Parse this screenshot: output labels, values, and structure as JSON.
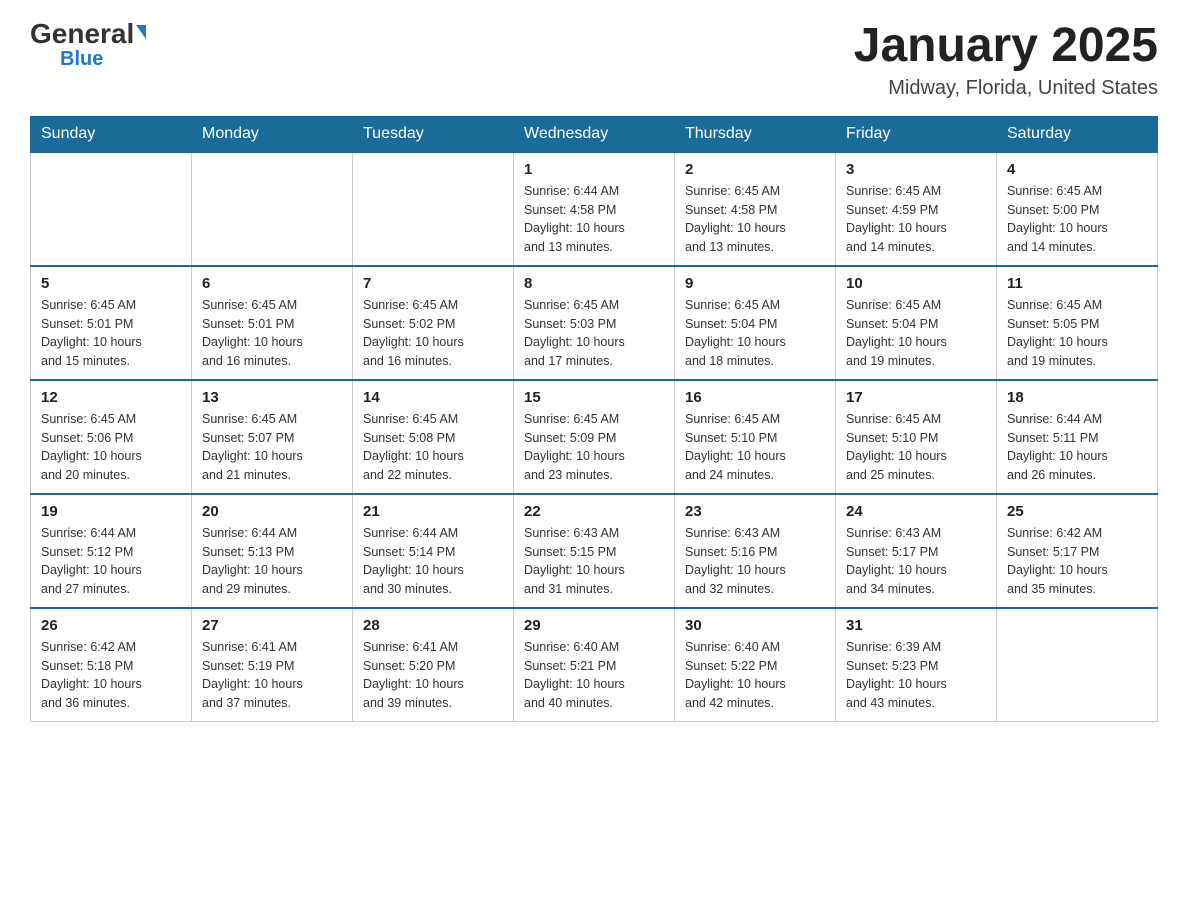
{
  "header": {
    "logo_general": "General",
    "logo_blue": "Blue",
    "month_title": "January 2025",
    "location": "Midway, Florida, United States"
  },
  "days_of_week": [
    "Sunday",
    "Monday",
    "Tuesday",
    "Wednesday",
    "Thursday",
    "Friday",
    "Saturday"
  ],
  "weeks": [
    [
      {
        "day": "",
        "info": ""
      },
      {
        "day": "",
        "info": ""
      },
      {
        "day": "",
        "info": ""
      },
      {
        "day": "1",
        "info": "Sunrise: 6:44 AM\nSunset: 4:58 PM\nDaylight: 10 hours\nand 13 minutes."
      },
      {
        "day": "2",
        "info": "Sunrise: 6:45 AM\nSunset: 4:58 PM\nDaylight: 10 hours\nand 13 minutes."
      },
      {
        "day": "3",
        "info": "Sunrise: 6:45 AM\nSunset: 4:59 PM\nDaylight: 10 hours\nand 14 minutes."
      },
      {
        "day": "4",
        "info": "Sunrise: 6:45 AM\nSunset: 5:00 PM\nDaylight: 10 hours\nand 14 minutes."
      }
    ],
    [
      {
        "day": "5",
        "info": "Sunrise: 6:45 AM\nSunset: 5:01 PM\nDaylight: 10 hours\nand 15 minutes."
      },
      {
        "day": "6",
        "info": "Sunrise: 6:45 AM\nSunset: 5:01 PM\nDaylight: 10 hours\nand 16 minutes."
      },
      {
        "day": "7",
        "info": "Sunrise: 6:45 AM\nSunset: 5:02 PM\nDaylight: 10 hours\nand 16 minutes."
      },
      {
        "day": "8",
        "info": "Sunrise: 6:45 AM\nSunset: 5:03 PM\nDaylight: 10 hours\nand 17 minutes."
      },
      {
        "day": "9",
        "info": "Sunrise: 6:45 AM\nSunset: 5:04 PM\nDaylight: 10 hours\nand 18 minutes."
      },
      {
        "day": "10",
        "info": "Sunrise: 6:45 AM\nSunset: 5:04 PM\nDaylight: 10 hours\nand 19 minutes."
      },
      {
        "day": "11",
        "info": "Sunrise: 6:45 AM\nSunset: 5:05 PM\nDaylight: 10 hours\nand 19 minutes."
      }
    ],
    [
      {
        "day": "12",
        "info": "Sunrise: 6:45 AM\nSunset: 5:06 PM\nDaylight: 10 hours\nand 20 minutes."
      },
      {
        "day": "13",
        "info": "Sunrise: 6:45 AM\nSunset: 5:07 PM\nDaylight: 10 hours\nand 21 minutes."
      },
      {
        "day": "14",
        "info": "Sunrise: 6:45 AM\nSunset: 5:08 PM\nDaylight: 10 hours\nand 22 minutes."
      },
      {
        "day": "15",
        "info": "Sunrise: 6:45 AM\nSunset: 5:09 PM\nDaylight: 10 hours\nand 23 minutes."
      },
      {
        "day": "16",
        "info": "Sunrise: 6:45 AM\nSunset: 5:10 PM\nDaylight: 10 hours\nand 24 minutes."
      },
      {
        "day": "17",
        "info": "Sunrise: 6:45 AM\nSunset: 5:10 PM\nDaylight: 10 hours\nand 25 minutes."
      },
      {
        "day": "18",
        "info": "Sunrise: 6:44 AM\nSunset: 5:11 PM\nDaylight: 10 hours\nand 26 minutes."
      }
    ],
    [
      {
        "day": "19",
        "info": "Sunrise: 6:44 AM\nSunset: 5:12 PM\nDaylight: 10 hours\nand 27 minutes."
      },
      {
        "day": "20",
        "info": "Sunrise: 6:44 AM\nSunset: 5:13 PM\nDaylight: 10 hours\nand 29 minutes."
      },
      {
        "day": "21",
        "info": "Sunrise: 6:44 AM\nSunset: 5:14 PM\nDaylight: 10 hours\nand 30 minutes."
      },
      {
        "day": "22",
        "info": "Sunrise: 6:43 AM\nSunset: 5:15 PM\nDaylight: 10 hours\nand 31 minutes."
      },
      {
        "day": "23",
        "info": "Sunrise: 6:43 AM\nSunset: 5:16 PM\nDaylight: 10 hours\nand 32 minutes."
      },
      {
        "day": "24",
        "info": "Sunrise: 6:43 AM\nSunset: 5:17 PM\nDaylight: 10 hours\nand 34 minutes."
      },
      {
        "day": "25",
        "info": "Sunrise: 6:42 AM\nSunset: 5:17 PM\nDaylight: 10 hours\nand 35 minutes."
      }
    ],
    [
      {
        "day": "26",
        "info": "Sunrise: 6:42 AM\nSunset: 5:18 PM\nDaylight: 10 hours\nand 36 minutes."
      },
      {
        "day": "27",
        "info": "Sunrise: 6:41 AM\nSunset: 5:19 PM\nDaylight: 10 hours\nand 37 minutes."
      },
      {
        "day": "28",
        "info": "Sunrise: 6:41 AM\nSunset: 5:20 PM\nDaylight: 10 hours\nand 39 minutes."
      },
      {
        "day": "29",
        "info": "Sunrise: 6:40 AM\nSunset: 5:21 PM\nDaylight: 10 hours\nand 40 minutes."
      },
      {
        "day": "30",
        "info": "Sunrise: 6:40 AM\nSunset: 5:22 PM\nDaylight: 10 hours\nand 42 minutes."
      },
      {
        "day": "31",
        "info": "Sunrise: 6:39 AM\nSunset: 5:23 PM\nDaylight: 10 hours\nand 43 minutes."
      },
      {
        "day": "",
        "info": ""
      }
    ]
  ]
}
